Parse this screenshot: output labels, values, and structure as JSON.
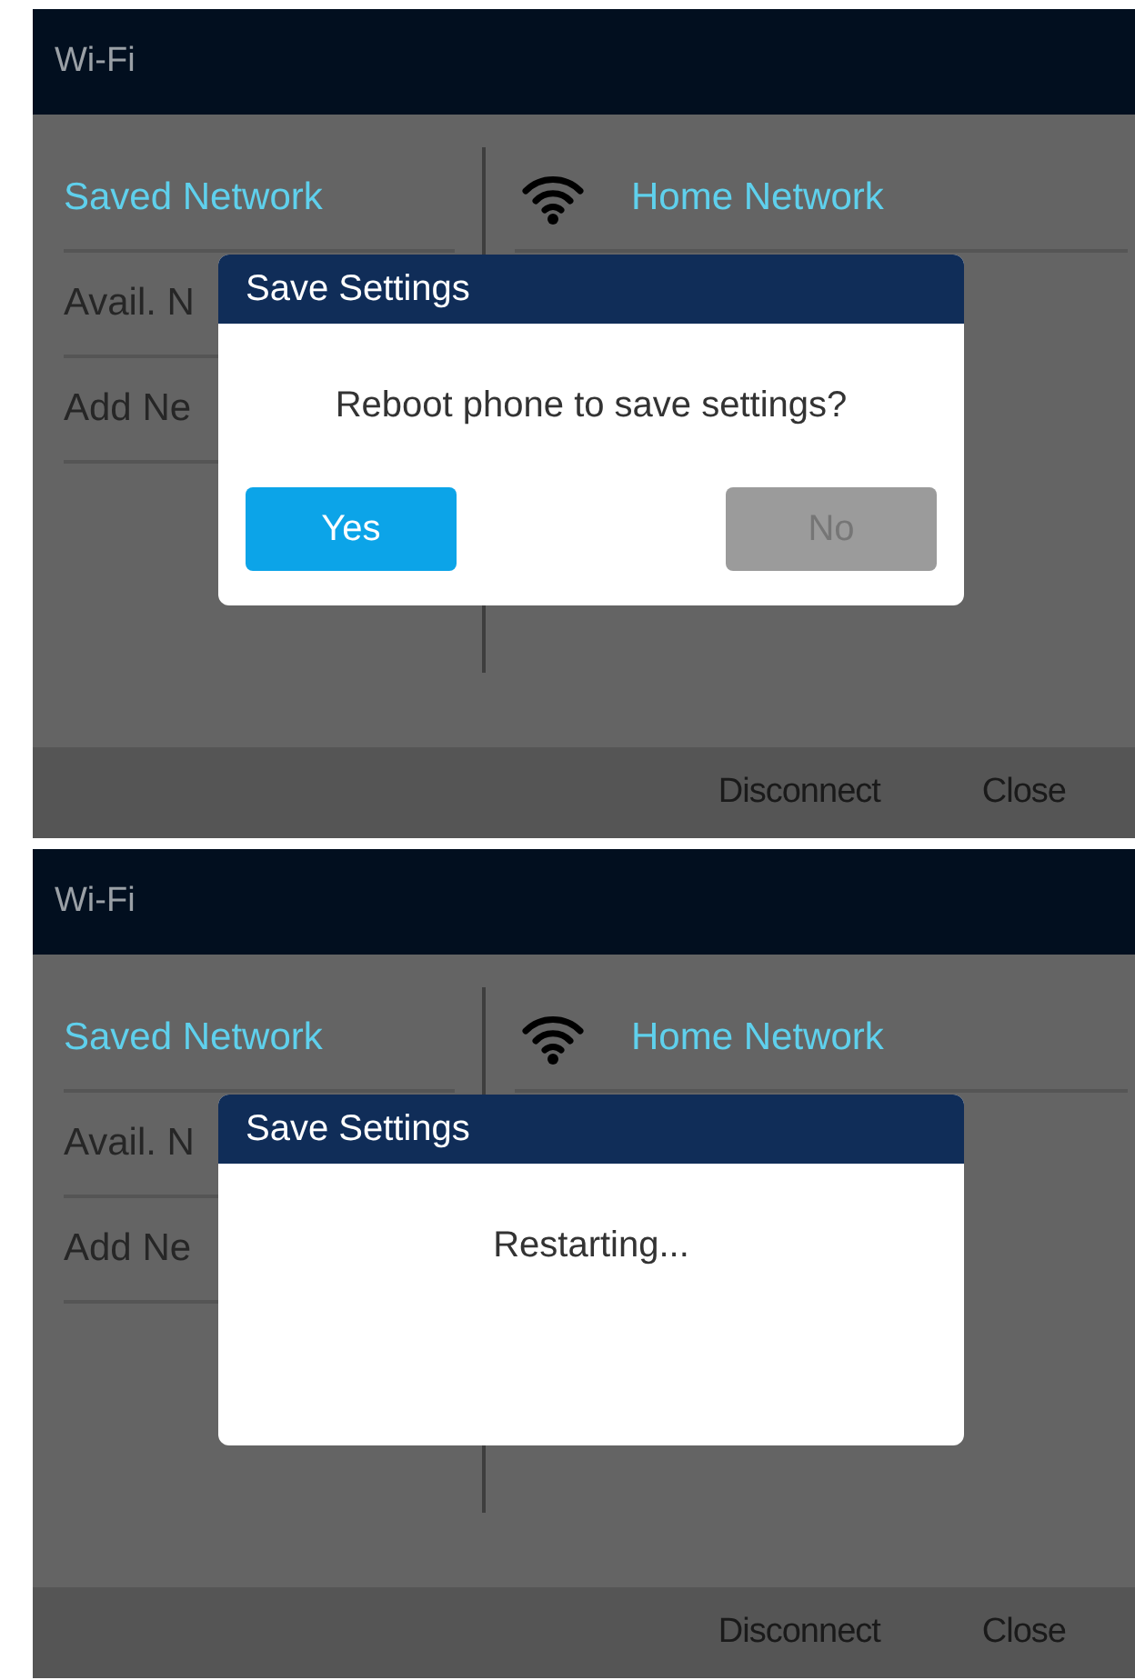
{
  "screens": [
    {
      "title": "Wi-Fi",
      "menu": [
        {
          "label": "Saved Network",
          "selected": true
        },
        {
          "label": "Avail. N",
          "selected": false
        },
        {
          "label": "Add Ne",
          "selected": false
        }
      ],
      "network": {
        "name": "Home Network"
      },
      "dialog": {
        "title": "Save Settings",
        "message": "Reboot phone to save settings?",
        "buttons": [
          {
            "label": "Yes",
            "selected": true
          },
          {
            "label": "No",
            "selected": false
          }
        ]
      },
      "softkeys": [
        "Disconnect",
        "Close"
      ]
    },
    {
      "title": "Wi-Fi",
      "menu": [
        {
          "label": "Saved Network",
          "selected": true
        },
        {
          "label": "Avail. N",
          "selected": false
        },
        {
          "label": "Add Ne",
          "selected": false
        }
      ],
      "network": {
        "name": "Home Network"
      },
      "dialog": {
        "title": "Save Settings",
        "message": "Restarting..."
      },
      "softkeys": [
        "Disconnect",
        "Close"
      ]
    }
  ]
}
